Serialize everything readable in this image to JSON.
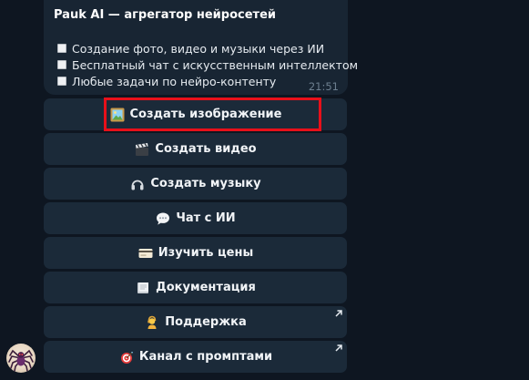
{
  "message": {
    "title": "Pauk AI — агрегатор нейросетей",
    "features": [
      "Создание фото, видео и музыки через ИИ",
      "Бесплатный чат с искусственным интеллектом",
      "Любые задачи по нейро-контенту"
    ],
    "time": "21:51"
  },
  "keyboard": {
    "buttons": [
      {
        "label": "Создать изображение",
        "icon": "framed-picture-icon",
        "external": false
      },
      {
        "label": "Создать видео",
        "icon": "clapper-icon",
        "external": false
      },
      {
        "label": "Создать музыку",
        "icon": "headphones-icon",
        "external": false
      },
      {
        "label": "Чат с ИИ",
        "icon": "speech-bubble-icon",
        "external": false
      },
      {
        "label": "Изучить цены",
        "icon": "credit-card-icon",
        "external": false
      },
      {
        "label": "Документация",
        "icon": "book-icon",
        "external": false
      },
      {
        "label": "Поддержка",
        "icon": "support-agent-icon",
        "external": true
      },
      {
        "label": "Канал с промптами",
        "icon": "target-icon",
        "external": true
      }
    ]
  },
  "colors": {
    "background": "#0e1621",
    "bubble": "#182533",
    "button": "#1b2a39",
    "highlight": "#e8101a",
    "time": "#6d7f8f"
  }
}
